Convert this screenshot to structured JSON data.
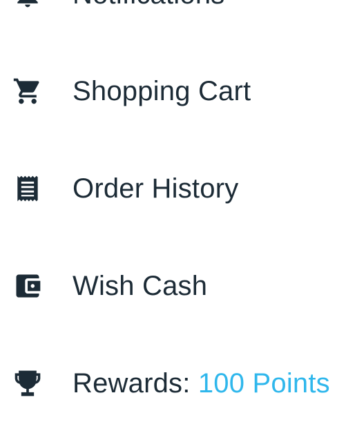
{
  "menu": {
    "items": [
      {
        "key": "notifications",
        "label": "Notifications",
        "icon": "bell-icon"
      },
      {
        "key": "cart",
        "label": "Shopping Cart",
        "icon": "shopping-cart-icon"
      },
      {
        "key": "orders",
        "label": "Order History",
        "icon": "receipt-icon"
      },
      {
        "key": "wishcash",
        "label": "Wish Cash",
        "icon": "wallet-icon"
      },
      {
        "key": "rewards",
        "label": "Rewards: ",
        "value": "100 Points",
        "icon": "trophy-icon"
      }
    ]
  },
  "colors": {
    "text": "#1c2b36",
    "accent": "#2fb7ec",
    "icon": "#1c2b36"
  }
}
